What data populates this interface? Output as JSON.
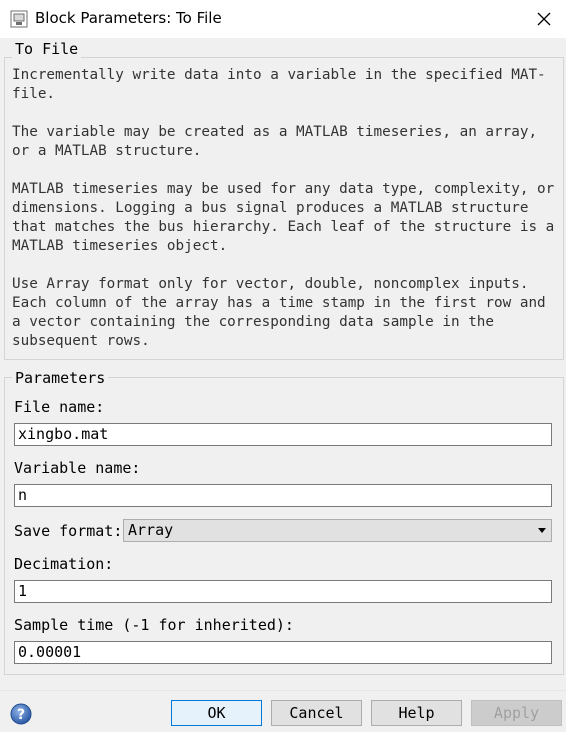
{
  "window": {
    "title": "Block Parameters: To File"
  },
  "block_group": {
    "legend": "To File",
    "description": "Incrementally write data into a variable in the specified MAT-\nfile.\n\nThe variable may be created as a MATLAB timeseries, an array,\nor a MATLAB structure.\n\nMATLAB timeseries may be used for any data type, complexity, or\ndimensions. Logging a bus signal produces a MATLAB structure\nthat matches the bus hierarchy. Each leaf of the structure is a\nMATLAB timeseries object.\n\nUse Array format only for vector, double, noncomplex inputs.\nEach column of the array has a time stamp in the first row and\na vector containing the corresponding data sample in the\nsubsequent rows."
  },
  "params_group": {
    "legend": "Parameters",
    "file_name": {
      "label": "File name:",
      "value": "xingbo.mat"
    },
    "variable_name": {
      "label": "Variable name:",
      "value": "n"
    },
    "save_format": {
      "label": "Save format:",
      "value": "Array"
    },
    "decimation": {
      "label": "Decimation:",
      "value": "1"
    },
    "sample_time": {
      "label": "Sample time (-1 for inherited):",
      "value": "0.00001"
    }
  },
  "buttons": {
    "ok": "OK",
    "cancel": "Cancel",
    "help": "Help",
    "apply": "Apply"
  }
}
